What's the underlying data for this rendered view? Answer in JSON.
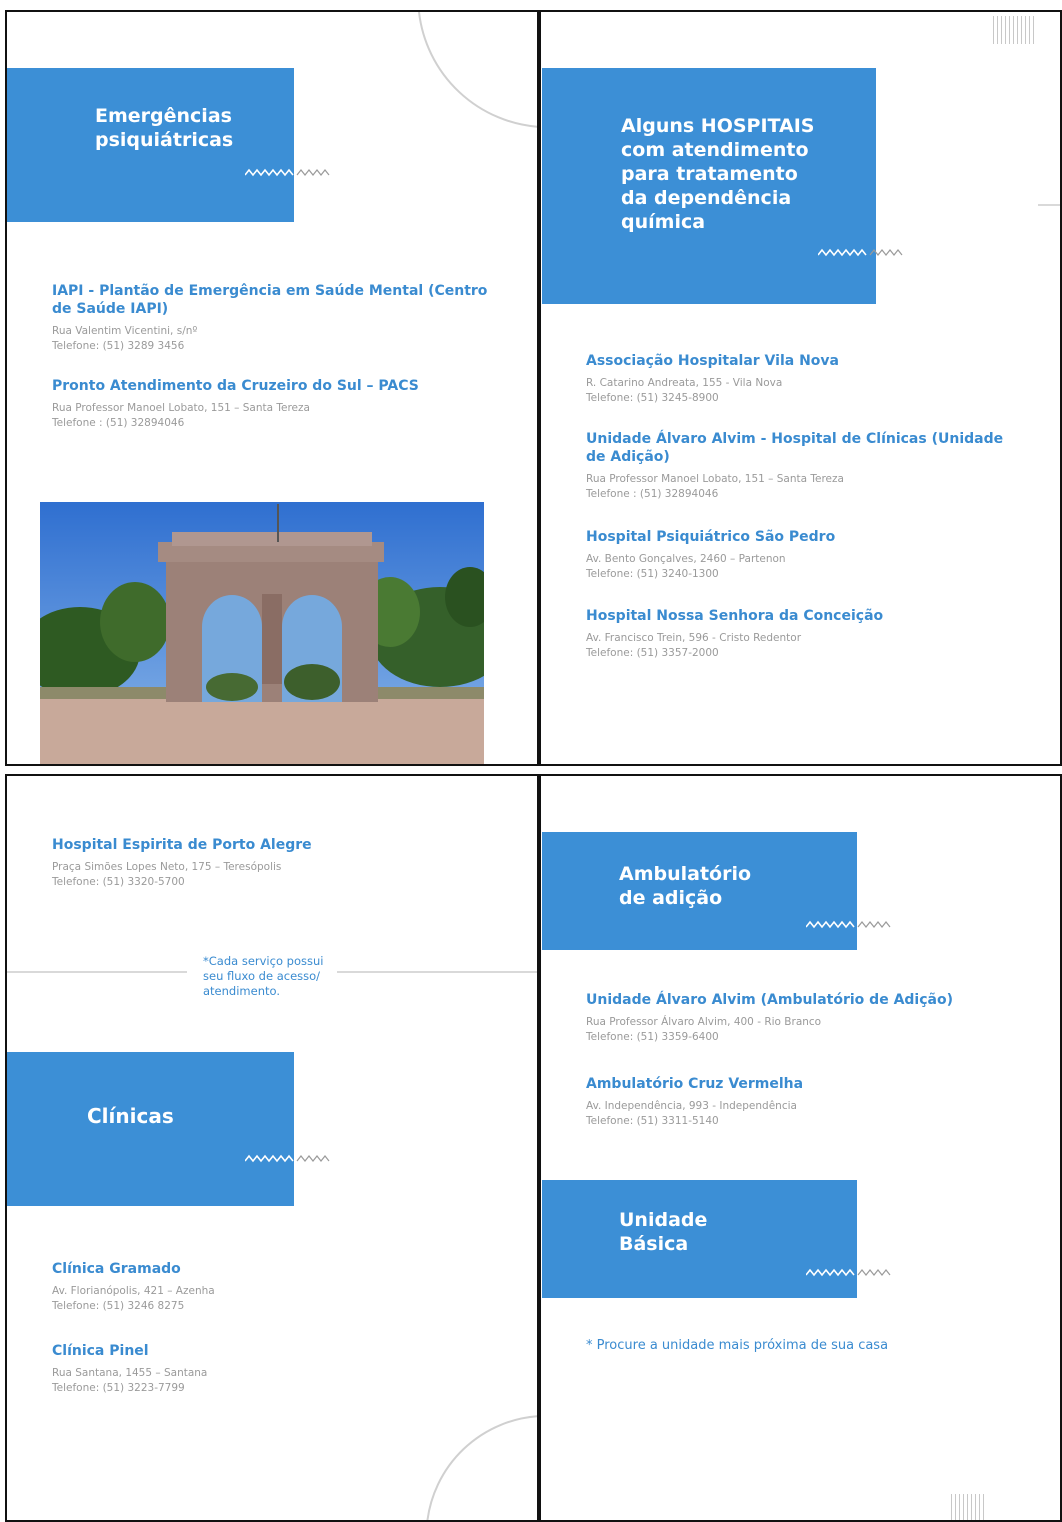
{
  "panel1": {
    "box_title": "Emergências\npsiquiátricas",
    "entries": [
      {
        "name": "IAPI - Plantão de Emergência em Saúde Mental (Centro de Saúde IAPI)",
        "address": "Rua Valentim Vicentini, s/nº",
        "phone": "Telefone: (51) 3289 3456"
      },
      {
        "name": "Pronto Atendimento da Cruzeiro do Sul – PACS",
        "address": "Rua Professor Manoel Lobato, 151 – Santa Tereza",
        "phone": "Telefone : (51) 32894046"
      }
    ]
  },
  "panel2": {
    "box_title": "Alguns HOSPITAIS\ncom atendimento\npara tratamento\nda dependência\nquímica",
    "entries": [
      {
        "name": "Associação Hospitalar Vila Nova",
        "address": "R. Catarino Andreata, 155 - Vila Nova",
        "phone": "Telefone: (51) 3245-8900"
      },
      {
        "name": "Unidade Álvaro Alvim  - Hospital de Clínicas (Unidade de Adição)",
        "address": "Rua Professor Manoel Lobato, 151 – Santa Tereza",
        "phone": "Telefone : (51) 32894046"
      },
      {
        "name": "Hospital  Psiquiátrico São Pedro",
        "address": "Av. Bento Gonçalves, 2460 – Partenon",
        "phone": "Telefone: (51) 3240-1300"
      },
      {
        "name": "Hospital Nossa Senhora da Conceição",
        "address": "Av. Francisco Trein, 596 - Cristo Redentor",
        "phone": "Telefone: (51) 3357-2000"
      }
    ]
  },
  "panel3": {
    "entries_top": [
      {
        "name": "Hospital Espirita de Porto Alegre",
        "address": "Praça Simões Lopes Neto, 175 – Teresópolis",
        "phone": "Telefone: (51) 3320-5700"
      }
    ],
    "note": "*Cada serviço possui\nseu fluxo de acesso/\natendimento.",
    "box_title": "Clínicas",
    "entries_bottom": [
      {
        "name": "Clínica Gramado",
        "address": "Av. Florianópolis, 421 – Azenha",
        "phone": "Telefone: (51) 3246 8275"
      },
      {
        "name": "Clínica Pinel",
        "address": "Rua Santana, 1455 – Santana",
        "phone": "Telefone: (51) 3223-7799"
      }
    ]
  },
  "panel4": {
    "box1_title": "Ambulatório\nde adição",
    "entries": [
      {
        "name": "Unidade Álvaro Alvim (Ambulatório de Adição)",
        "address": "Rua Professor Álvaro Alvim, 400 - Rio Branco",
        "phone": "Telefone: (51) 3359-6400"
      },
      {
        "name": "Ambulatório Cruz Vermelha",
        "address": "Av. Independência, 993 - Independência",
        "phone": "Telefone: (51) 3311-5140"
      }
    ],
    "box2_title": "Unidade\nBásica",
    "note": "* Procure a unidade mais próxima de sua casa"
  },
  "colors": {
    "accent": "#3c8fd6",
    "text_blue": "#3a8bd0",
    "text_gray": "#9a9a9a"
  }
}
